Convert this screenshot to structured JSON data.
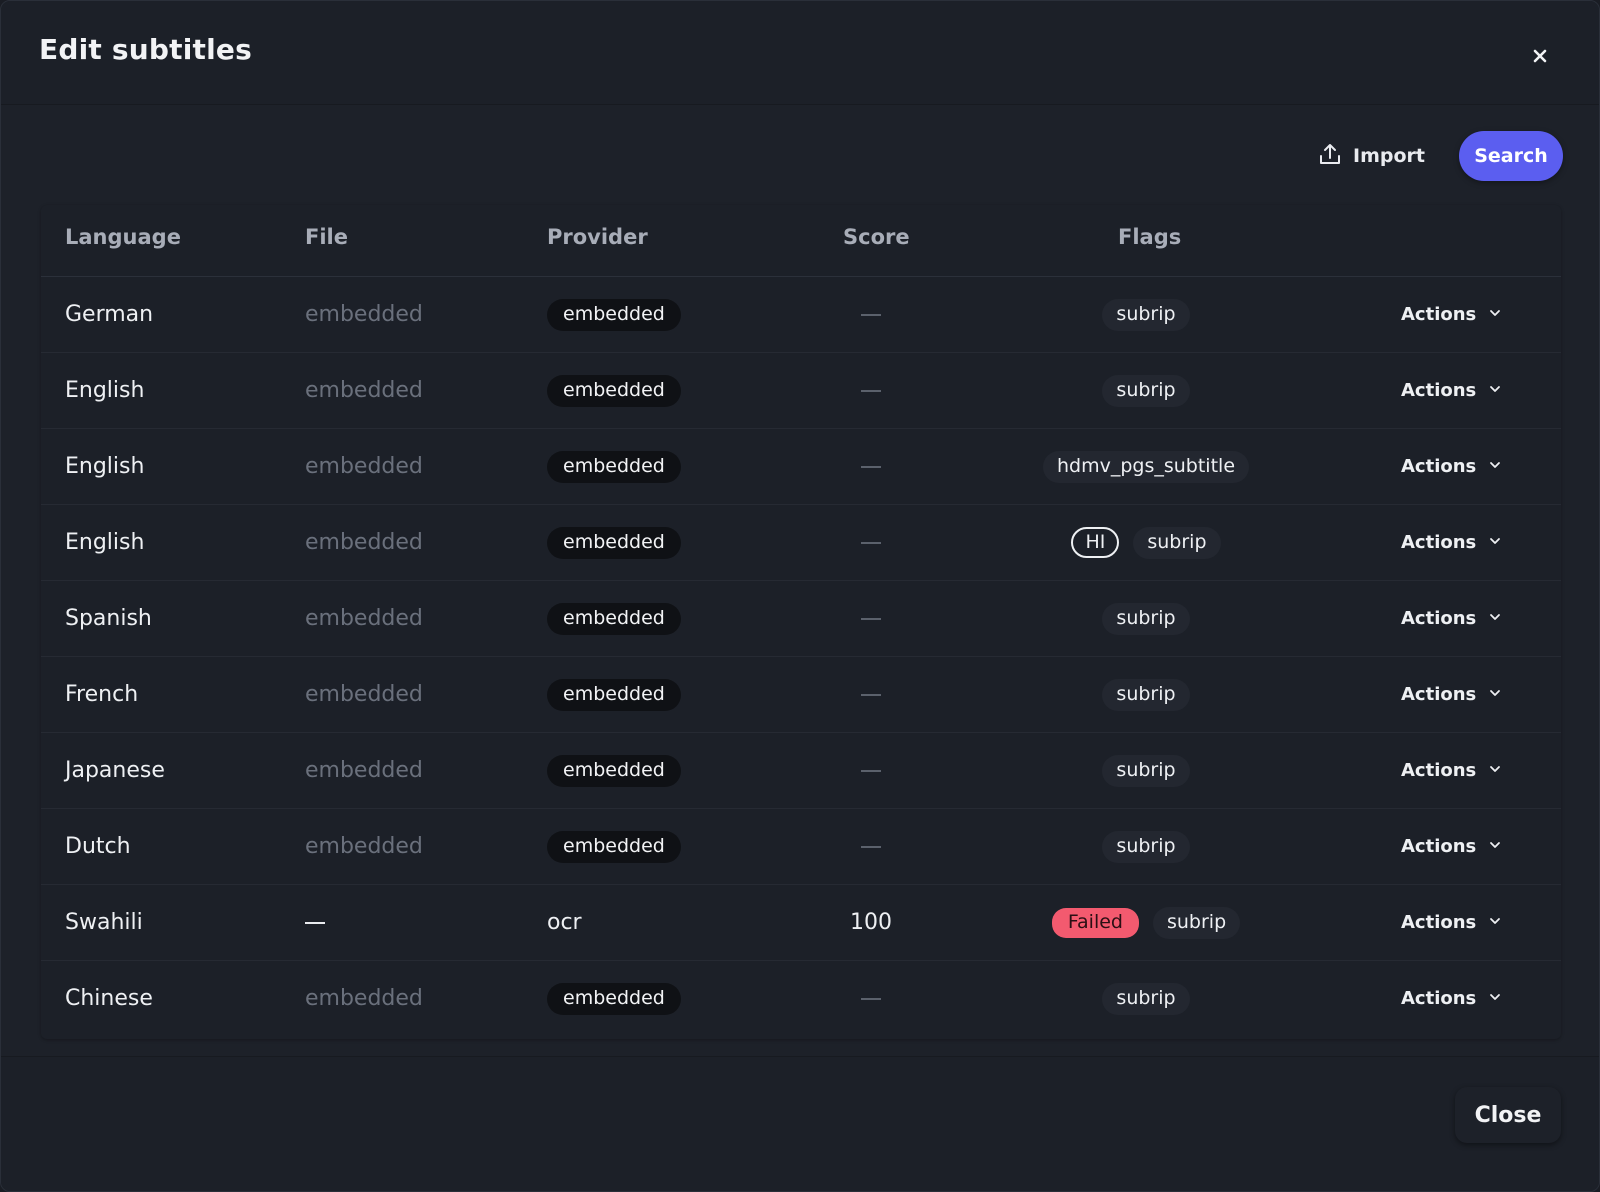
{
  "modal": {
    "title": "Edit subtitles",
    "close_icon": "close-icon"
  },
  "toolbar": {
    "import_label": "Import",
    "import_icon": "upload-icon",
    "search_label": "Search"
  },
  "table": {
    "columns": [
      "Language",
      "File",
      "Provider",
      "Score",
      "Flags"
    ],
    "rows": [
      {
        "language": "German",
        "file": "embedded",
        "provider": "embedded",
        "score": "—",
        "flags": [
          {
            "text": "subrip",
            "style": "flag"
          }
        ],
        "actions": "Actions"
      },
      {
        "language": "English",
        "file": "embedded",
        "provider": "embedded",
        "score": "—",
        "flags": [
          {
            "text": "subrip",
            "style": "flag"
          }
        ],
        "actions": "Actions"
      },
      {
        "language": "English",
        "file": "embedded",
        "provider": "embedded",
        "score": "—",
        "flags": [
          {
            "text": "hdmv_pgs_subtitle",
            "style": "flag"
          }
        ],
        "actions": "Actions"
      },
      {
        "language": "English",
        "file": "embedded",
        "provider": "embedded",
        "score": "—",
        "flags": [
          {
            "text": "HI",
            "style": "outline"
          },
          {
            "text": "subrip",
            "style": "flag"
          }
        ],
        "actions": "Actions"
      },
      {
        "language": "Spanish",
        "file": "embedded",
        "provider": "embedded",
        "score": "—",
        "flags": [
          {
            "text": "subrip",
            "style": "flag"
          }
        ],
        "actions": "Actions"
      },
      {
        "language": "French",
        "file": "embedded",
        "provider": "embedded",
        "score": "—",
        "flags": [
          {
            "text": "subrip",
            "style": "flag"
          }
        ],
        "actions": "Actions"
      },
      {
        "language": "Japanese",
        "file": "embedded",
        "provider": "embedded",
        "score": "—",
        "flags": [
          {
            "text": "subrip",
            "style": "flag"
          }
        ],
        "actions": "Actions"
      },
      {
        "language": "Dutch",
        "file": "embedded",
        "provider": "embedded",
        "score": "—",
        "flags": [
          {
            "text": "subrip",
            "style": "flag"
          }
        ],
        "actions": "Actions"
      },
      {
        "language": "Swahili",
        "file": "—",
        "provider": "ocr",
        "score": "100",
        "flags": [
          {
            "text": "Failed",
            "style": "failed"
          },
          {
            "text": "subrip",
            "style": "flag"
          }
        ],
        "actions": "Actions"
      },
      {
        "language": "Chinese",
        "file": "embedded",
        "provider": "embedded",
        "score": "—",
        "flags": [
          {
            "text": "subrip",
            "style": "flag"
          }
        ],
        "actions": "Actions"
      }
    ]
  },
  "footer": {
    "close_label": "Close"
  },
  "colors": {
    "accent": "#5b5ef0",
    "failed": "#f35a6f",
    "background": "#1d2129"
  }
}
